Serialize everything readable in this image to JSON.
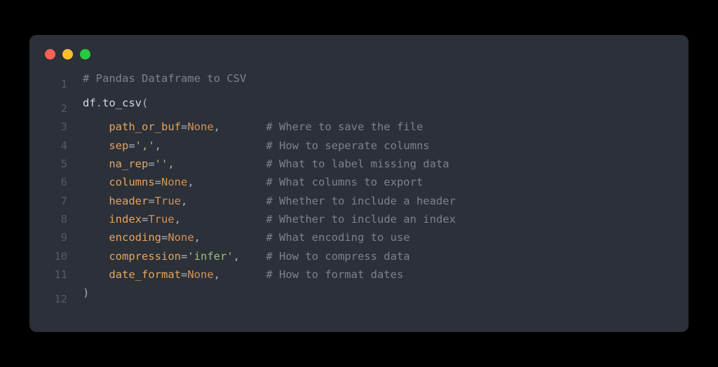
{
  "code": {
    "lines": [
      {
        "n": "1",
        "indent": "",
        "tokens": [
          {
            "t": "# Pandas Dataframe to CSV",
            "c": "comment"
          }
        ],
        "comment": ""
      },
      {
        "n": "2",
        "indent": "",
        "tokens": [
          {
            "t": "df",
            "c": "ident"
          },
          {
            "t": ".",
            "c": "dot"
          },
          {
            "t": "to_csv",
            "c": "ident"
          },
          {
            "t": "(",
            "c": "punct"
          }
        ],
        "comment": ""
      },
      {
        "n": "3",
        "indent": "    ",
        "tokens": [
          {
            "t": "path_or_buf",
            "c": "param"
          },
          {
            "t": "=",
            "c": "punct"
          },
          {
            "t": "None",
            "c": "value-none"
          },
          {
            "t": ",",
            "c": "punct"
          }
        ],
        "comment": "# Where to save the file"
      },
      {
        "n": "4",
        "indent": "    ",
        "tokens": [
          {
            "t": "sep",
            "c": "param"
          },
          {
            "t": "=",
            "c": "punct"
          },
          {
            "t": "','",
            "c": "string"
          },
          {
            "t": ",",
            "c": "punct"
          }
        ],
        "comment": "# How to seperate columns"
      },
      {
        "n": "5",
        "indent": "    ",
        "tokens": [
          {
            "t": "na_rep",
            "c": "param"
          },
          {
            "t": "=",
            "c": "punct"
          },
          {
            "t": "''",
            "c": "string"
          },
          {
            "t": ",",
            "c": "punct"
          }
        ],
        "comment": "# What to label missing data"
      },
      {
        "n": "6",
        "indent": "    ",
        "tokens": [
          {
            "t": "columns",
            "c": "param"
          },
          {
            "t": "=",
            "c": "punct"
          },
          {
            "t": "None",
            "c": "value-none"
          },
          {
            "t": ",",
            "c": "punct"
          }
        ],
        "comment": "# What columns to export"
      },
      {
        "n": "7",
        "indent": "    ",
        "tokens": [
          {
            "t": "header",
            "c": "param"
          },
          {
            "t": "=",
            "c": "punct"
          },
          {
            "t": "True",
            "c": "value-bool"
          },
          {
            "t": ",",
            "c": "punct"
          }
        ],
        "comment": "# Whether to include a header"
      },
      {
        "n": "8",
        "indent": "    ",
        "tokens": [
          {
            "t": "index",
            "c": "param"
          },
          {
            "t": "=",
            "c": "punct"
          },
          {
            "t": "True",
            "c": "value-bool"
          },
          {
            "t": ",",
            "c": "punct"
          }
        ],
        "comment": "# Whether to include an index"
      },
      {
        "n": "9",
        "indent": "    ",
        "tokens": [
          {
            "t": "encoding",
            "c": "param"
          },
          {
            "t": "=",
            "c": "punct"
          },
          {
            "t": "None",
            "c": "value-none"
          },
          {
            "t": ",",
            "c": "punct"
          }
        ],
        "comment": "# What encoding to use"
      },
      {
        "n": "10",
        "indent": "    ",
        "tokens": [
          {
            "t": "compression",
            "c": "param"
          },
          {
            "t": "=",
            "c": "punct"
          },
          {
            "t": "'infer'",
            "c": "string"
          },
          {
            "t": ",",
            "c": "punct"
          }
        ],
        "comment": "# How to compress data"
      },
      {
        "n": "11",
        "indent": "    ",
        "tokens": [
          {
            "t": "date_format",
            "c": "param"
          },
          {
            "t": "=",
            "c": "punct"
          },
          {
            "t": "None",
            "c": "value-none"
          },
          {
            "t": ",",
            "c": "punct"
          }
        ],
        "comment": "# How to format dates"
      },
      {
        "n": "12",
        "indent": "",
        "tokens": [
          {
            "t": ")",
            "c": "punct"
          }
        ],
        "comment": ""
      }
    ],
    "comment_column": 28
  }
}
